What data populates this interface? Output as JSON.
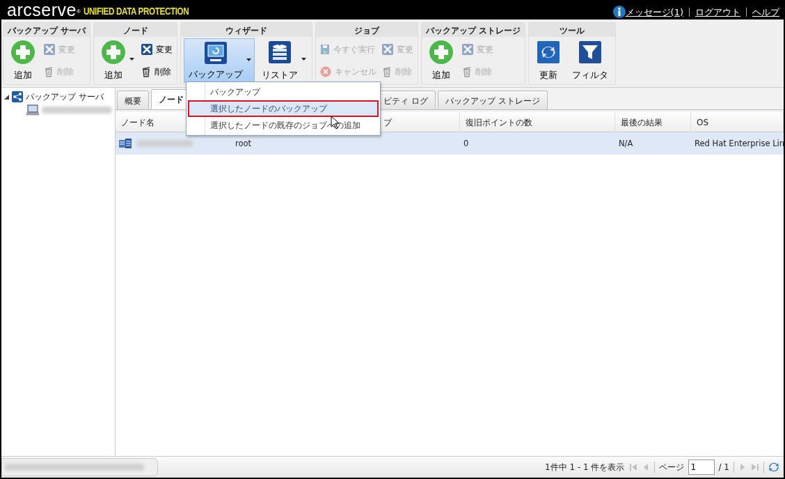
{
  "header": {
    "logo": "arcserve",
    "logo_mark": "®",
    "product": "UNIFIED DATA PROTECTION",
    "links": [
      "メッセージ(1)",
      "ログアウト",
      "ヘルプ"
    ]
  },
  "toolbar": [
    {
      "title": "バックアップ サーバ",
      "items": [
        {
          "label": "追加",
          "kind": "large",
          "disabled": false,
          "dropdown": false,
          "selected": false
        },
        {
          "label": "変更",
          "kind": "small",
          "disabled": true
        },
        {
          "label": "削除",
          "kind": "small",
          "disabled": true
        }
      ]
    },
    {
      "title": "ノード",
      "items": [
        {
          "label": "追加",
          "kind": "large",
          "disabled": false,
          "dropdown": true,
          "selected": false
        },
        {
          "label": "変更",
          "kind": "small",
          "disabled": false
        },
        {
          "label": "削除",
          "kind": "small",
          "disabled": false
        }
      ]
    },
    {
      "title": "ウィザード",
      "items": [
        {
          "label": "バックアップ",
          "kind": "large",
          "disabled": false,
          "dropdown": true,
          "selected": true
        },
        {
          "label": "リストア",
          "kind": "large",
          "disabled": false,
          "dropdown": true,
          "selected": false
        }
      ]
    },
    {
      "title": "ジョブ",
      "items": [
        {
          "label": "今すぐ実行",
          "kind": "small",
          "disabled": true
        },
        {
          "label": "キャンセル",
          "kind": "small",
          "disabled": true
        },
        {
          "label": "変更",
          "kind": "small",
          "disabled": true
        },
        {
          "label": "削除",
          "kind": "small",
          "disabled": true
        }
      ]
    },
    {
      "title": "バックアップ ストレージ",
      "items": [
        {
          "label": "追加",
          "kind": "large",
          "disabled": false,
          "dropdown": false,
          "selected": false
        },
        {
          "label": "変更",
          "kind": "small",
          "disabled": true
        },
        {
          "label": "削除",
          "kind": "small",
          "disabled": true
        }
      ]
    },
    {
      "title": "ツール",
      "items": [
        {
          "label": "更新",
          "kind": "large",
          "disabled": false,
          "dropdown": false,
          "selected": false
        },
        {
          "label": "フィルタ",
          "kind": "large",
          "disabled": false,
          "dropdown": false,
          "selected": false
        }
      ]
    }
  ],
  "tree": {
    "label": "バックアップ サーバ",
    "expanded": true
  },
  "tabs": [
    {
      "label": "概要",
      "selected": false
    },
    {
      "label": "ノード",
      "selected": true
    },
    {
      "label": "ビティ ログ",
      "selected": false
    },
    {
      "label": "バックアップ ストレージ",
      "selected": false
    }
  ],
  "table": {
    "columns": [
      "ノード名",
      "",
      "ブ",
      "復旧ポイントの数",
      "最後の結果",
      "OS"
    ],
    "rows": [
      {
        "cells": [
          "",
          "root",
          "",
          "0",
          "N/A",
          "Red Hat Enterprise Lin"
        ],
        "selected": true
      }
    ]
  },
  "menu": {
    "items": [
      {
        "label": "バックアップ",
        "selected": false
      },
      {
        "label": "選択したノードのバックアップ",
        "selected": true
      },
      {
        "label": "選択したノードの既存のジョブへの追加",
        "selected": false
      }
    ]
  },
  "pager": {
    "summary": "1件中 1 - 1 件を表示",
    "page_label": "ページ",
    "page": "1",
    "total": "/ 1"
  }
}
